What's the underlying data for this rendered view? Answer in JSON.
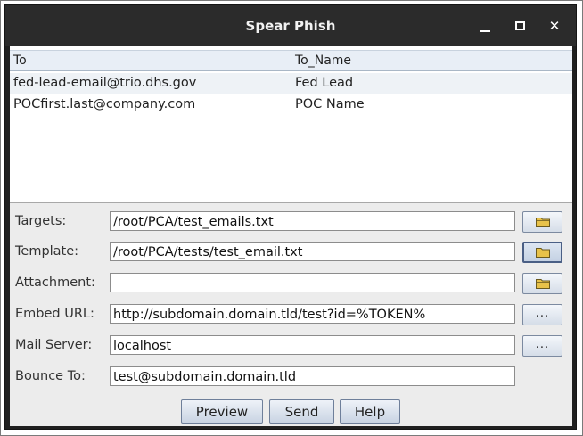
{
  "window": {
    "title": "Spear Phish",
    "controls": {
      "minimize": "minimize",
      "maximize": "maximize",
      "close": "✕"
    }
  },
  "table": {
    "columns": [
      "To",
      "To_Name"
    ],
    "rows": [
      {
        "to": "fed-lead-email@trio.dhs.gov",
        "to_name": "Fed Lead"
      },
      {
        "to": "POCfirst.last@company.com",
        "to_name": "POC Name"
      }
    ]
  },
  "form": {
    "targets": {
      "label": "Targets:",
      "value": "/root/PCA/test_emails.txt",
      "button": "folder-icon"
    },
    "template": {
      "label": "Template:",
      "value": "/root/PCA/tests/test_email.txt",
      "button": "folder-icon"
    },
    "attachment": {
      "label": "Attachment:",
      "value": "",
      "button": "folder-icon"
    },
    "embed_url": {
      "label": "Embed URL:",
      "value": "http://subdomain.domain.tld/test?id=%TOKEN%",
      "button": "..."
    },
    "mail_server": {
      "label": "Mail Server:",
      "value": "localhost",
      "button": "..."
    },
    "bounce_to": {
      "label": "Bounce To:",
      "value": "test@subdomain.domain.tld"
    }
  },
  "actions": {
    "preview": "Preview",
    "send": "Send",
    "help": "Help"
  },
  "colors": {
    "titlebar": "#2b2b2b",
    "panel": "#ececec",
    "row_alt": "#eef2f6",
    "header": "#e8eef6",
    "folder": "#e8c24a"
  }
}
